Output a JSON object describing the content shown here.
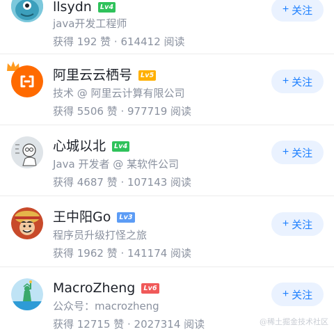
{
  "users": [
    {
      "name": "llsydn",
      "level": "Lv4",
      "level_color": "#2fc25b",
      "desc": "java开发工程师",
      "stats": "获得 192 赞 · 614412 阅读",
      "follow_label": "关注",
      "avatar_icon": "fish-monster-avatar"
    },
    {
      "name": "阿里云云栖号",
      "level": "Lv5",
      "level_color": "#ffb000",
      "desc": "技术 @ 阿里云计算有限公司",
      "stats": "获得 5506 赞 · 977719 阅读",
      "follow_label": "关注",
      "avatar_icon": "aliyun-logo-avatar"
    },
    {
      "name": "心城以北",
      "level": "Lv4",
      "level_color": "#2fc25b",
      "desc": "Java 开发者 @ 某软件公司",
      "stats": "获得 4687 赞 · 107143 阅读",
      "follow_label": "关注",
      "avatar_icon": "sketch-avatar"
    },
    {
      "name": "王中阳Go",
      "level": "Lv3",
      "level_color": "#5c9cf5",
      "desc": "程序员升级打怪之旅",
      "stats": "获得 1962 赞 · 141174 阅读",
      "follow_label": "关注",
      "avatar_icon": "luffy-avatar"
    },
    {
      "name": "MacroZheng",
      "level": "Lv6",
      "level_color": "#f05959",
      "desc": "公众号：macrozheng",
      "stats": "获得 12715 赞 · 2027314 阅读",
      "follow_label": "关注",
      "avatar_icon": "statue-of-liberty-avatar"
    }
  ],
  "follow_plus": "+",
  "watermark": "@稀土掘金技术社区",
  "colors": {
    "accent": "#1e80ff",
    "follow_bg": "#eaf2ff",
    "secondary_text": "#8a919f",
    "primary_text": "#1d2129"
  }
}
